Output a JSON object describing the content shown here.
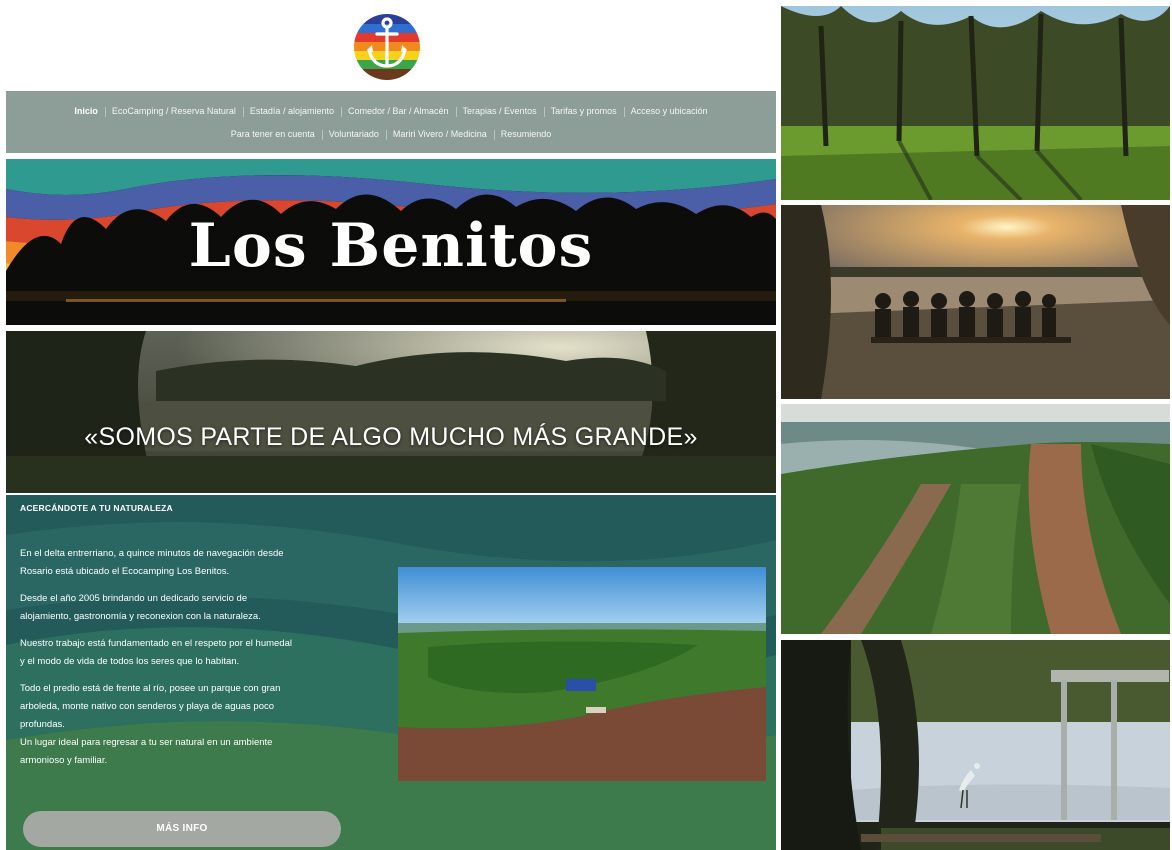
{
  "site": {
    "nav": {
      "row1": [
        "Inicio",
        "EcoCamping / Reserva Natural",
        "Estadía / alojamiento",
        "Comedor / Bar / Almacén",
        "Terapias / Eventos",
        "Tarifas y promos",
        "Acceso y ubicación"
      ],
      "row2": [
        "Para tener en cuenta",
        "Voluntariado",
        "Mariri Vivero / Medicina",
        "Resumiendo"
      ],
      "active": "Inicio"
    },
    "hero": {
      "title": "Los Benitos"
    },
    "banner": {
      "quote": "«SOMOS PARTE DE ALGO MUCHO MÁS GRANDE»"
    },
    "about": {
      "heading": "ACERCÁNDOTE A TU NATURALEZA",
      "paragraph1_line1": "En el delta entrerriano, a quince minutos de navegación desde",
      "paragraph1_line2": "Rosario está ubicado el Ecocamping Los Benitos.",
      "paragraph2_line1": "Desde el año 2005 brindando un dedicado servicio de",
      "paragraph2_line2": "alojamiento, gastronomía y reconexion con la naturaleza.",
      "paragraph3_line1": "Nuestro trabajo está fundamentado en el respeto por el humedal",
      "paragraph3_line2": "y el modo de vida de todos los seres que lo habitan.",
      "paragraph4_line1": "Todo el predio está de frente al río, posee un parque con gran",
      "paragraph4_line2": "arboleda, monte nativo con senderos y playa de aguas poco",
      "paragraph4_line3": "profundas.",
      "paragraph5_line1": "Un lugar ideal para regresar a tu ser natural en un ambiente",
      "paragraph5_line2": "armonioso y familiar.",
      "button_label": "MÁS INFO"
    }
  },
  "colors": {
    "nav_bg": "#8d9d98",
    "about_bg": "#235b5a",
    "button_bg": "#a3a8a2"
  },
  "icons": {
    "logo": "anchor-rainbow-logo"
  }
}
